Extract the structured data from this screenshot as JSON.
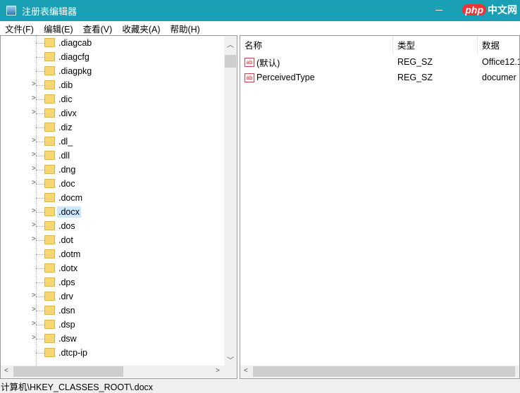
{
  "title": "注册表编辑器",
  "watermark": "php中文网",
  "menu": [
    "文件(F)",
    "编辑(E)",
    "查看(V)",
    "收藏夹(A)",
    "帮助(H)"
  ],
  "tree": [
    {
      "label": ".diagcab",
      "expandable": false
    },
    {
      "label": ".diagcfg",
      "expandable": false
    },
    {
      "label": ".diagpkg",
      "expandable": false
    },
    {
      "label": ".dib",
      "expandable": true
    },
    {
      "label": ".dic",
      "expandable": true
    },
    {
      "label": ".divx",
      "expandable": true
    },
    {
      "label": ".diz",
      "expandable": false
    },
    {
      "label": ".dl_",
      "expandable": true
    },
    {
      "label": ".dll",
      "expandable": true
    },
    {
      "label": ".dng",
      "expandable": true
    },
    {
      "label": ".doc",
      "expandable": true
    },
    {
      "label": ".docm",
      "expandable": false
    },
    {
      "label": ".docx",
      "expandable": true,
      "selected": true
    },
    {
      "label": ".dos",
      "expandable": true
    },
    {
      "label": ".dot",
      "expandable": true
    },
    {
      "label": ".dotm",
      "expandable": false
    },
    {
      "label": ".dotx",
      "expandable": false
    },
    {
      "label": ".dps",
      "expandable": false
    },
    {
      "label": ".drv",
      "expandable": true
    },
    {
      "label": ".dsn",
      "expandable": true
    },
    {
      "label": ".dsp",
      "expandable": true
    },
    {
      "label": ".dsw",
      "expandable": true
    },
    {
      "label": ".dtcp-ip",
      "expandable": false
    }
  ],
  "columns": {
    "name": "名称",
    "type": "类型",
    "data": "数据"
  },
  "values": [
    {
      "name": "(默认)",
      "type": "REG_SZ",
      "data": "Office12.1"
    },
    {
      "name": "PerceivedType",
      "type": "REG_SZ",
      "data": "documer"
    }
  ],
  "status": "计算机\\HKEY_CLASSES_ROOT\\.docx"
}
